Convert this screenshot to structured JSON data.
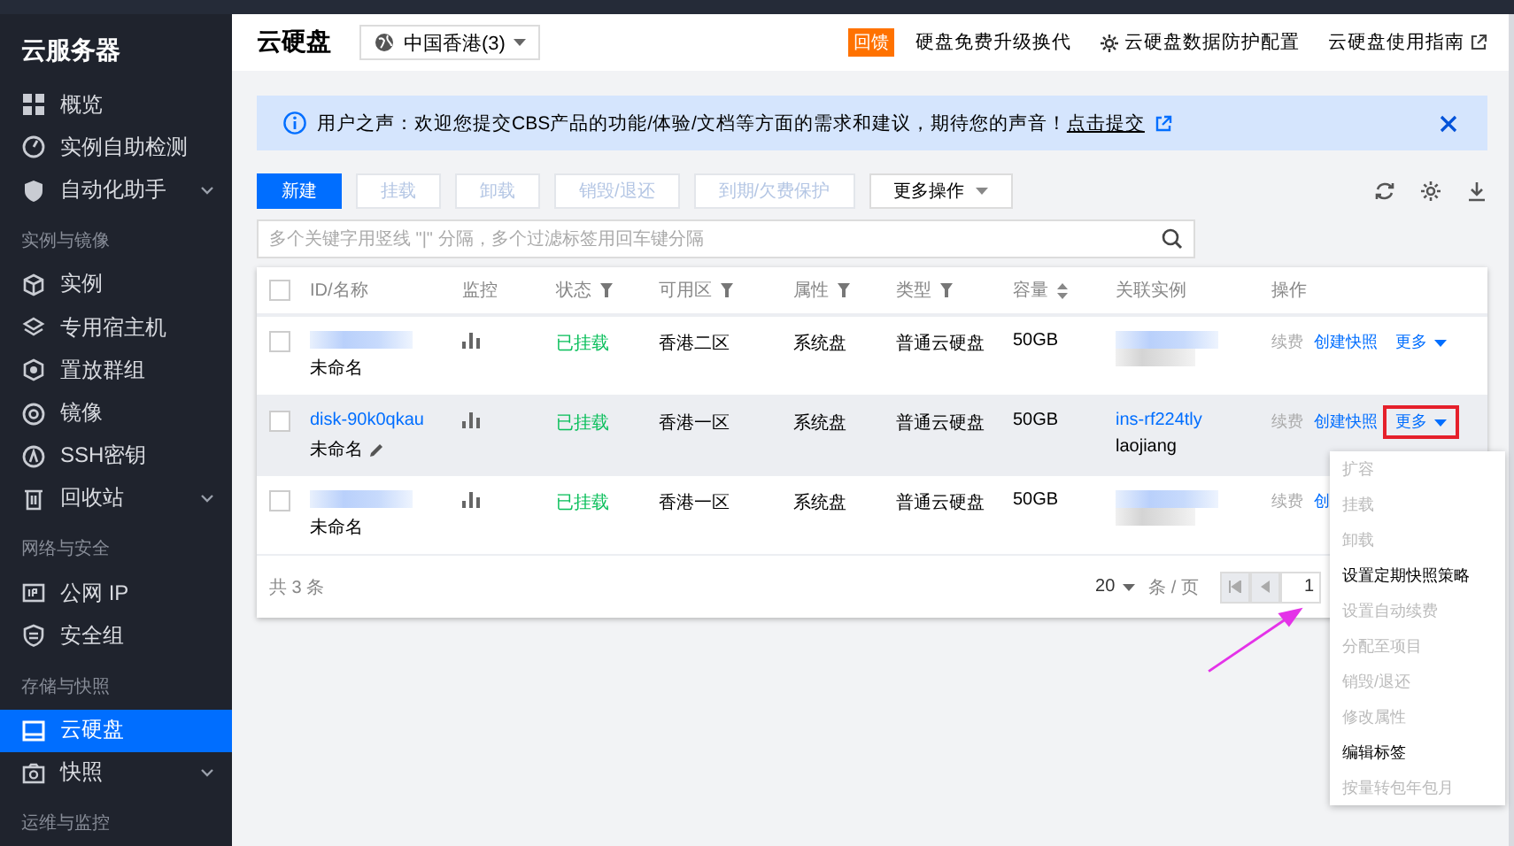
{
  "sidebar": {
    "title": "云服务器",
    "items": [
      {
        "kind": "item",
        "label": "概览",
        "selected": false,
        "submenu": false
      },
      {
        "kind": "item",
        "label": "实例自助检测",
        "selected": false,
        "submenu": false
      },
      {
        "kind": "item",
        "label": "自动化助手",
        "selected": false,
        "submenu": true
      },
      {
        "kind": "heading",
        "label": "实例与镜像"
      },
      {
        "kind": "item",
        "label": "实例",
        "selected": false,
        "submenu": false
      },
      {
        "kind": "item",
        "label": "专用宿主机",
        "selected": false,
        "submenu": false
      },
      {
        "kind": "item",
        "label": "置放群组",
        "selected": false,
        "submenu": false
      },
      {
        "kind": "item",
        "label": "镜像",
        "selected": false,
        "submenu": false
      },
      {
        "kind": "item",
        "label": "SSH密钥",
        "selected": false,
        "submenu": false
      },
      {
        "kind": "item",
        "label": "回收站",
        "selected": false,
        "submenu": true
      },
      {
        "kind": "heading",
        "label": "网络与安全"
      },
      {
        "kind": "item",
        "label": "公网 IP",
        "selected": false,
        "submenu": false
      },
      {
        "kind": "item",
        "label": "安全组",
        "selected": false,
        "submenu": false
      },
      {
        "kind": "heading",
        "label": "存储与快照"
      },
      {
        "kind": "item",
        "label": "云硬盘",
        "selected": true,
        "submenu": false
      },
      {
        "kind": "item",
        "label": "快照",
        "selected": false,
        "submenu": true
      },
      {
        "kind": "heading",
        "label": "运维与监控"
      }
    ]
  },
  "header": {
    "title": "云硬盘",
    "region": "中国香港(3)",
    "badge": "回馈",
    "links": [
      {
        "kind": "plain",
        "label": "硬盘免费升级换代"
      },
      {
        "kind": "settings",
        "label": "云硬盘数据防护配置"
      },
      {
        "kind": "external",
        "label": "云硬盘使用指南"
      }
    ]
  },
  "notice": {
    "text": "用户之声：欢迎您提交CBS产品的功能/体验/文档等方面的需求和建议，期待您的声音！",
    "link": "点击提交"
  },
  "toolbar": {
    "buttons": [
      {
        "kind": "primary",
        "label": "新建",
        "disabled": false
      },
      {
        "kind": "plain",
        "label": "挂载",
        "disabled": true
      },
      {
        "kind": "plain",
        "label": "卸载",
        "disabled": true
      },
      {
        "kind": "plain",
        "label": "销毁/退还",
        "disabled": true
      },
      {
        "kind": "plain",
        "label": "到期/欠费保护",
        "disabled": true
      },
      {
        "kind": "dropdown",
        "label": "更多操作",
        "disabled": false
      }
    ]
  },
  "search": {
    "placeholder": "多个关键字用竖线 \"|\" 分隔，多个过滤标签用回车键分隔"
  },
  "table": {
    "header_checked": false,
    "columns": [
      {
        "label": "ID/名称",
        "filter": false,
        "sort": false
      },
      {
        "label": "监控",
        "filter": false,
        "sort": false
      },
      {
        "label": "状态",
        "filter": true,
        "sort": false
      },
      {
        "label": "可用区",
        "filter": true,
        "sort": false
      },
      {
        "label": "属性",
        "filter": true,
        "sort": false
      },
      {
        "label": "类型",
        "filter": true,
        "sort": false
      },
      {
        "label": "容量",
        "filter": false,
        "sort": true
      },
      {
        "label": "关联实例",
        "filter": false,
        "sort": false
      },
      {
        "label": "操作",
        "filter": false,
        "sort": false
      }
    ],
    "rows": [
      {
        "checked": false,
        "selected": false,
        "redacted": true,
        "name": "未命名",
        "editable": false,
        "status": "已挂载",
        "zone": "香港二区",
        "attribute": "系统盘",
        "type": "普通云硬盘",
        "capacity": "50GB",
        "actions": [
          {
            "kind": "disabled",
            "label": "续费",
            "highlighted": false
          },
          {
            "kind": "link",
            "label": "创建快照",
            "highlighted": false
          },
          {
            "kind": "dropdown",
            "label": "更多",
            "highlighted": false
          }
        ]
      },
      {
        "checked": false,
        "selected": true,
        "redacted": false,
        "id": "disk-90k0qkau",
        "name": "未命名",
        "editable": true,
        "status": "已挂载",
        "zone": "香港一区",
        "attribute": "系统盘",
        "type": "普通云硬盘",
        "capacity": "50GB",
        "instance_id": "ins-rf224tly",
        "instance_name": "laojiang",
        "actions": [
          {
            "kind": "disabled",
            "label": "续费",
            "highlighted": false
          },
          {
            "kind": "link",
            "label": "创建快照",
            "highlighted": false
          },
          {
            "kind": "dropdown",
            "label": "更多",
            "highlighted": true
          }
        ]
      },
      {
        "checked": false,
        "selected": false,
        "redacted": true,
        "name": "未命名",
        "editable": false,
        "status": "已挂载",
        "zone": "香港一区",
        "attribute": "系统盘",
        "type": "普通云硬盘",
        "capacity": "50GB",
        "actions": [
          {
            "kind": "disabled",
            "label": "续费",
            "highlighted": false
          },
          {
            "kind": "link",
            "label": "创",
            "highlighted": false
          }
        ]
      }
    ],
    "total": "共 3 条",
    "page_size": "20",
    "page_size_unit": "条 / 页",
    "page": "1"
  },
  "menu": {
    "items": [
      {
        "label": "扩容",
        "disabled": true
      },
      {
        "label": "挂载",
        "disabled": true
      },
      {
        "label": "卸载",
        "disabled": true
      },
      {
        "label": "设置定期快照策略",
        "disabled": false
      },
      {
        "label": "设置自动续费",
        "disabled": true
      },
      {
        "label": "分配至项目",
        "disabled": true
      },
      {
        "label": "销毁/退还",
        "disabled": true
      },
      {
        "label": "修改属性",
        "disabled": true
      },
      {
        "label": "编辑标签",
        "disabled": false
      },
      {
        "label": "按量转包年包月",
        "disabled": true
      }
    ]
  },
  "annotations": [
    {
      "kind": "arrow",
      "color": "#e432e8"
    }
  ]
}
